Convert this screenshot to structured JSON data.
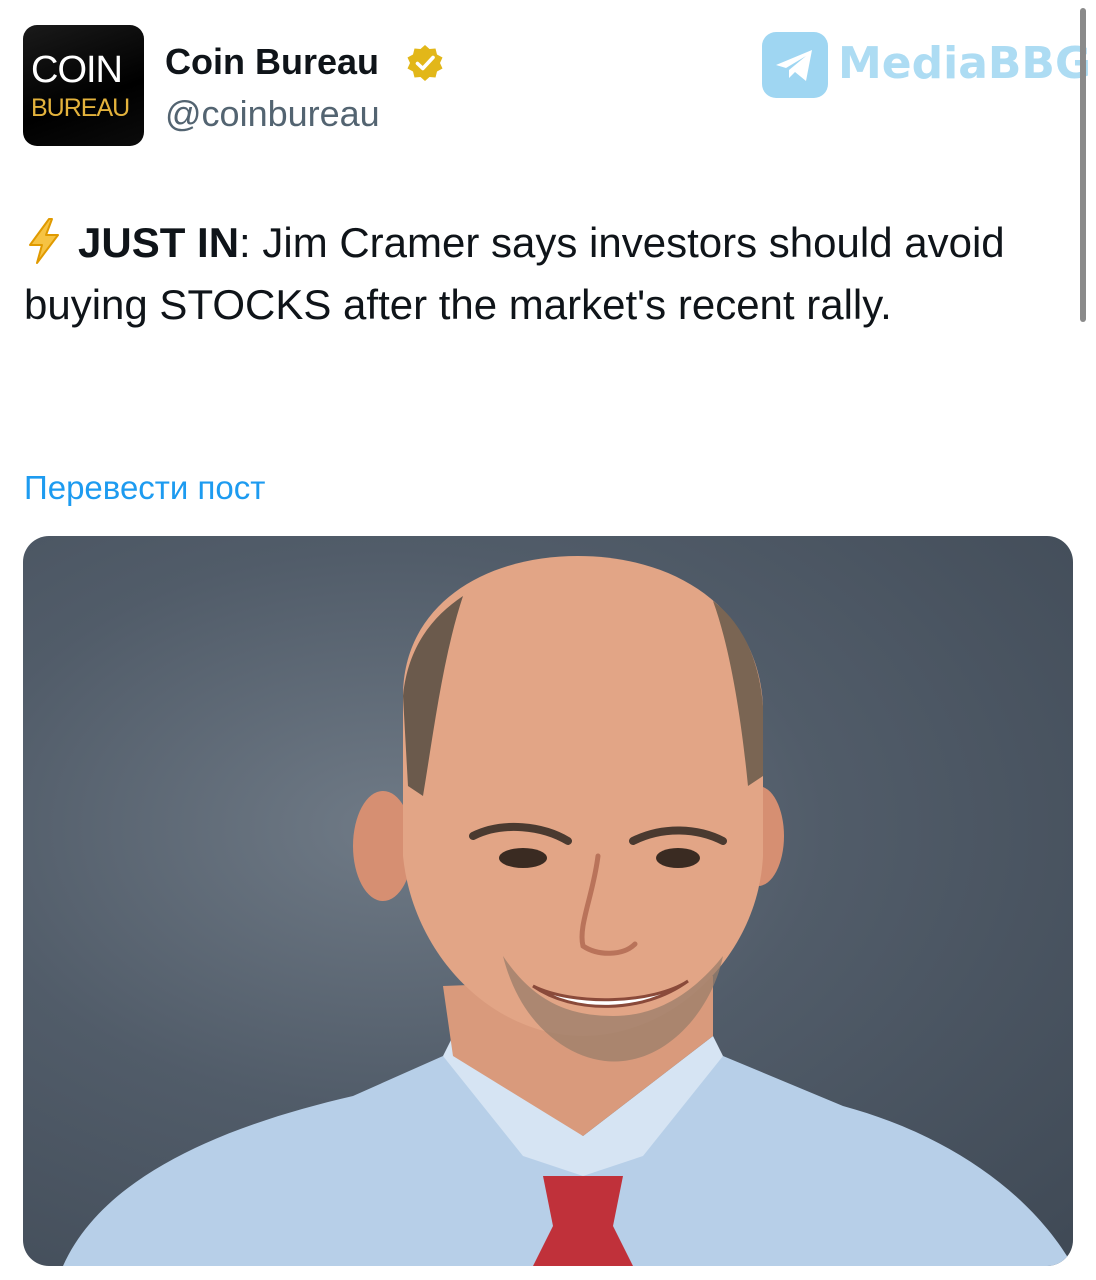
{
  "author": {
    "avatar_line1": "COIN",
    "avatar_line2": "BUREAU",
    "display_name": "Coin Bureau",
    "handle": "@coinbureau",
    "verified_badge": "gold-verified-badge-icon"
  },
  "watermark": {
    "icon": "telegram-icon",
    "text": "MediaBBG"
  },
  "tweet": {
    "emoji": "lightning-bolt-icon",
    "lead": "JUST IN",
    "body": ": Jim Cramer says investors should avoid buying STOCKS after the market's recent rally.",
    "translate_label": "Перевести пост"
  },
  "media": {
    "type": "photo",
    "subject": "portrait-photo"
  },
  "colors": {
    "text": "#0f1419",
    "secondary": "#536471",
    "link": "#1d9bf0",
    "badge_gold": "#e2b719",
    "bolt": "#f4b400"
  }
}
